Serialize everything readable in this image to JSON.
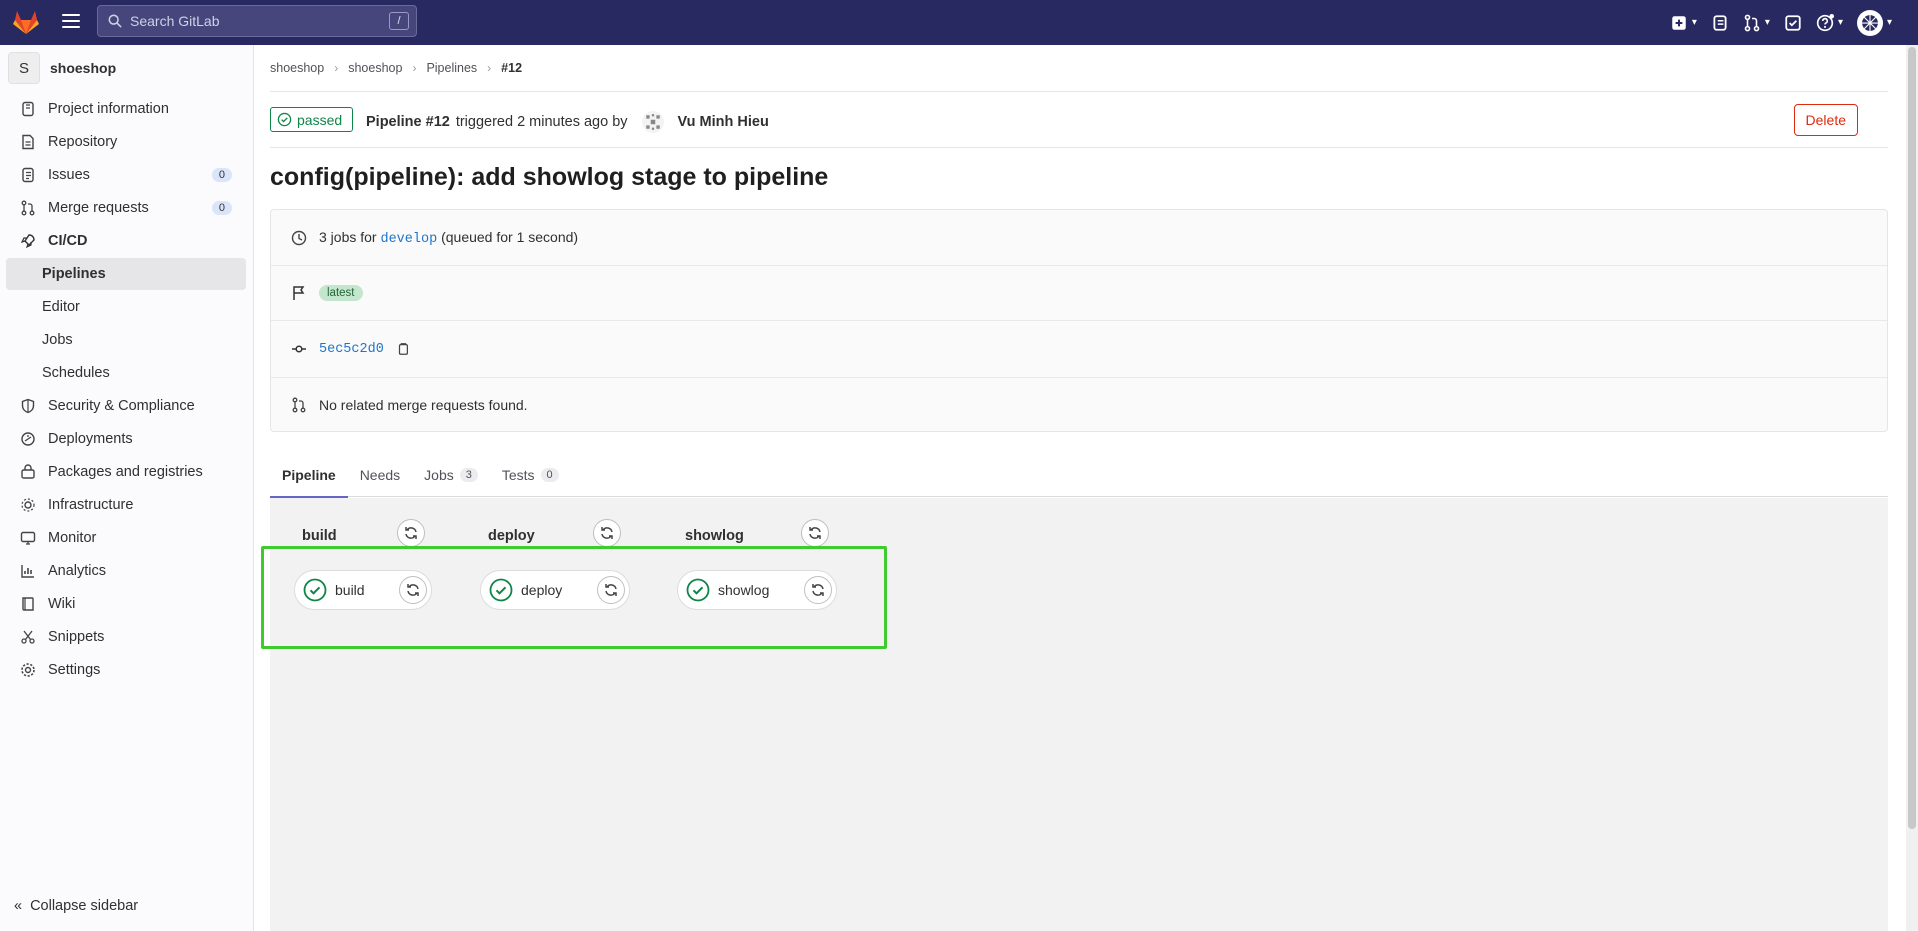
{
  "topnav": {
    "search_placeholder": "Search GitLab",
    "search_shortcut": "/"
  },
  "sidebar": {
    "project_initial": "S",
    "project_name": "shoeshop",
    "items": [
      {
        "label": "Project information",
        "icon": "info-icon"
      },
      {
        "label": "Repository",
        "icon": "doc-icon"
      },
      {
        "label": "Issues",
        "icon": "issues-icon",
        "count": "0"
      },
      {
        "label": "Merge requests",
        "icon": "merge-request-icon",
        "count": "0"
      },
      {
        "label": "CI/CD",
        "icon": "rocket-icon"
      },
      {
        "label": "Pipelines"
      },
      {
        "label": "Editor"
      },
      {
        "label": "Jobs"
      },
      {
        "label": "Schedules"
      },
      {
        "label": "Security & Compliance",
        "icon": "shield-icon"
      },
      {
        "label": "Deployments",
        "icon": "deployments-icon"
      },
      {
        "label": "Packages and registries",
        "icon": "package-icon"
      },
      {
        "label": "Infrastructure",
        "icon": "cloud-gear-icon"
      },
      {
        "label": "Monitor",
        "icon": "monitor-icon"
      },
      {
        "label": "Analytics",
        "icon": "chart-icon"
      },
      {
        "label": "Wiki",
        "icon": "book-icon"
      },
      {
        "label": "Snippets",
        "icon": "scissors-icon"
      },
      {
        "label": "Settings",
        "icon": "gear-icon"
      }
    ],
    "collapse_label": "Collapse sidebar"
  },
  "breadcrumb": [
    "shoeshop",
    "shoeshop",
    "Pipelines",
    "#12"
  ],
  "pipeline": {
    "status": "passed",
    "name": "Pipeline #12",
    "triggered_text": "triggered 2 minutes ago by",
    "user": "Vu Minh Hieu",
    "delete_label": "Delete",
    "title": "config(pipeline): add showlog stage to pipeline",
    "jobs_prefix": "3 jobs for",
    "branch": "develop",
    "queued": "(queued for 1 second)",
    "badge": "latest",
    "commit": "5ec5c2d0",
    "merge_requests": "No related merge requests found."
  },
  "tabs": [
    {
      "label": "Pipeline"
    },
    {
      "label": "Needs"
    },
    {
      "label": "Jobs",
      "count": "3"
    },
    {
      "label": "Tests",
      "count": "0"
    }
  ],
  "stages": [
    {
      "name": "build",
      "job": "build"
    },
    {
      "name": "deploy",
      "job": "deploy"
    },
    {
      "name": "showlog",
      "job": "showlog"
    }
  ],
  "colors": {
    "nav_bg": "#292961",
    "success": "#108548",
    "danger": "#dd2b0e",
    "link": "#1f75cb",
    "highlight": "#3fca2f"
  }
}
